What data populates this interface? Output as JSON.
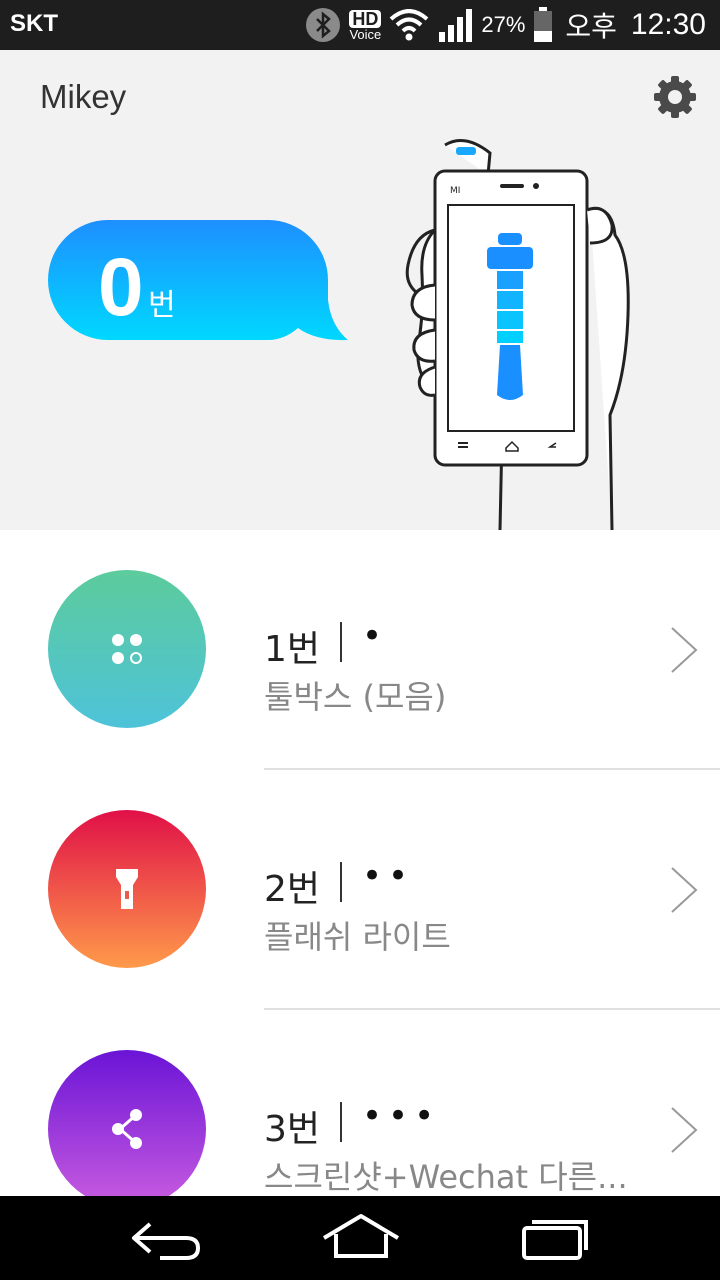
{
  "status_bar": {
    "carrier": "SKT",
    "hd_top": "HD",
    "hd_bottom": "Voice",
    "battery_percent": "27%",
    "ampm": "오후",
    "time": "12:30"
  },
  "header": {
    "title": "Mikey",
    "settings_icon": "gear-icon"
  },
  "counter": {
    "number": "0",
    "unit": "번"
  },
  "list": {
    "items": [
      {
        "number": "1번",
        "dots": "•",
        "label": "툴박스 (모음)",
        "icon": "four-dots-icon",
        "gradient": [
          "#5ccb9c",
          "#4ec3d9"
        ]
      },
      {
        "number": "2번",
        "dots": "••",
        "label": "플래쉬 라이트",
        "icon": "flashlight-icon",
        "gradient": [
          "#e01048",
          "#ff9a4a"
        ]
      },
      {
        "number": "3번",
        "dots": "•••",
        "label": "스크린샷+Wechat 다른...",
        "icon": "share-icon",
        "gradient": [
          "#6a14d6",
          "#c95ce0"
        ]
      }
    ]
  },
  "nav": {
    "back_icon": "back-icon",
    "home_icon": "home-icon",
    "recents_icon": "recents-icon"
  },
  "colors": {
    "bubble_top": "#1e8fff",
    "bubble_bottom": "#00d8ff",
    "accent_blue": "#1aa8ff"
  }
}
